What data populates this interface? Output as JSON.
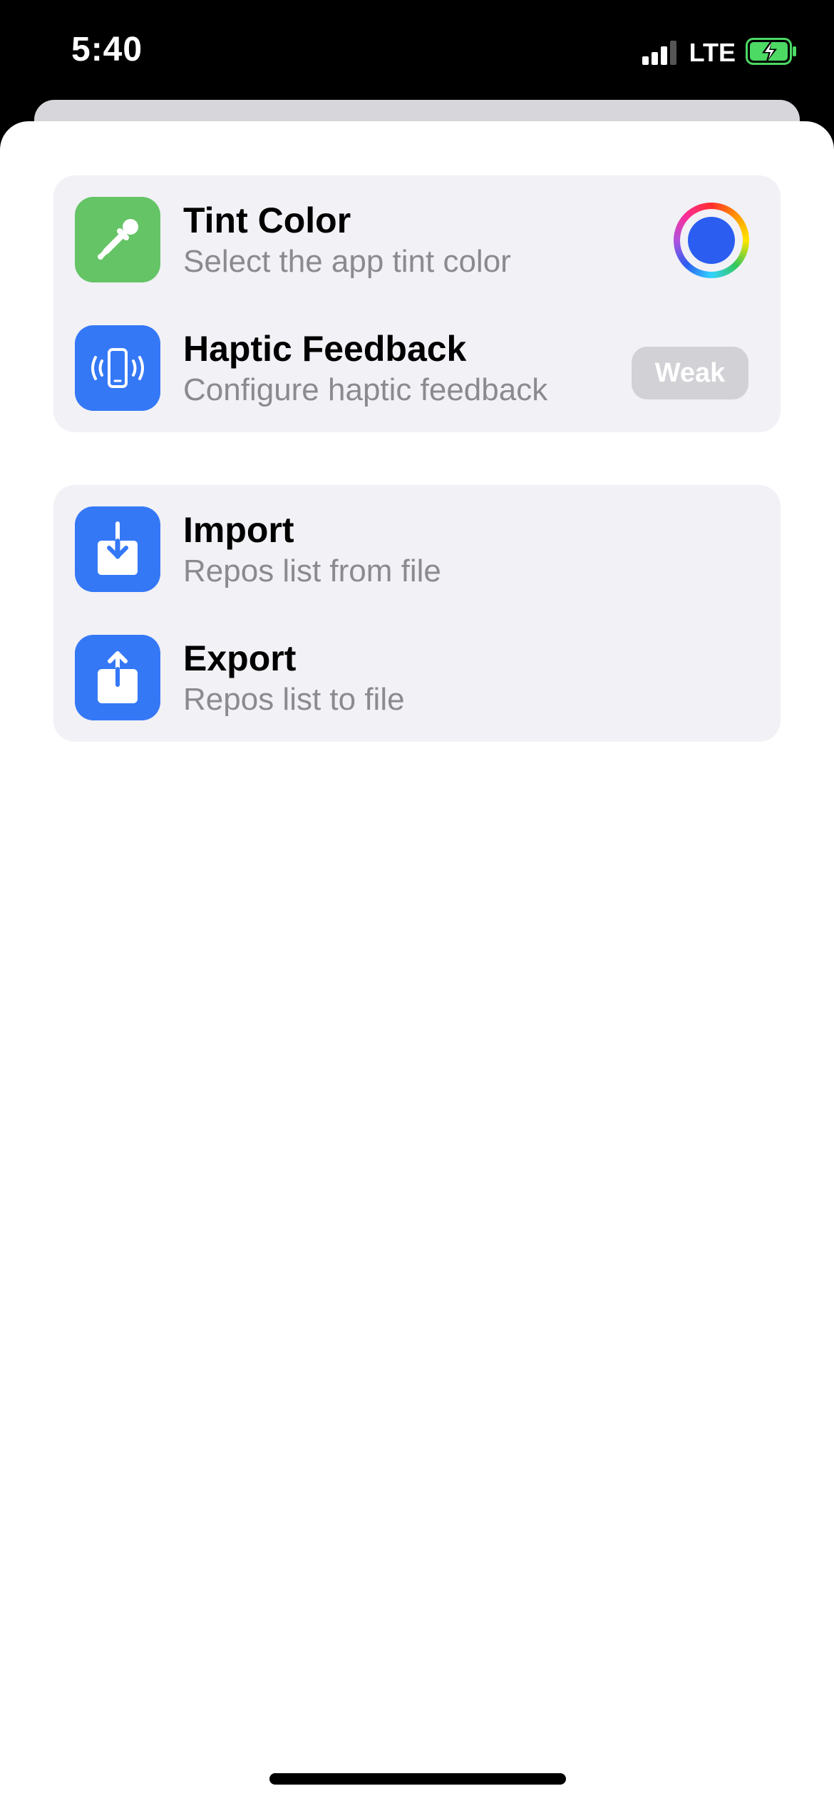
{
  "status_bar": {
    "time": "5:40",
    "network": "LTE",
    "signal_bars_active": 3,
    "signal_bars_total": 4,
    "battery_state": "charging",
    "battery_color": "#4cd964"
  },
  "groups": [
    {
      "rows": [
        {
          "title": "Tint Color",
          "subtitle": "Select the app tint color",
          "icon": "eyedropper-icon",
          "icon_bg": "#65c466",
          "current_color": "#2b5ef0"
        },
        {
          "title": "Haptic Feedback",
          "subtitle": "Configure haptic feedback",
          "icon": "phone-vibrate-icon",
          "icon_bg": "#3478f6",
          "value": "Weak"
        }
      ]
    },
    {
      "rows": [
        {
          "title": "Import",
          "subtitle": "Repos list from file",
          "icon": "tray-arrow-down-icon",
          "icon_bg": "#3478f6"
        },
        {
          "title": "Export",
          "subtitle": "Repos list to file",
          "icon": "square-arrow-up-icon",
          "icon_bg": "#3478f6"
        }
      ]
    }
  ]
}
